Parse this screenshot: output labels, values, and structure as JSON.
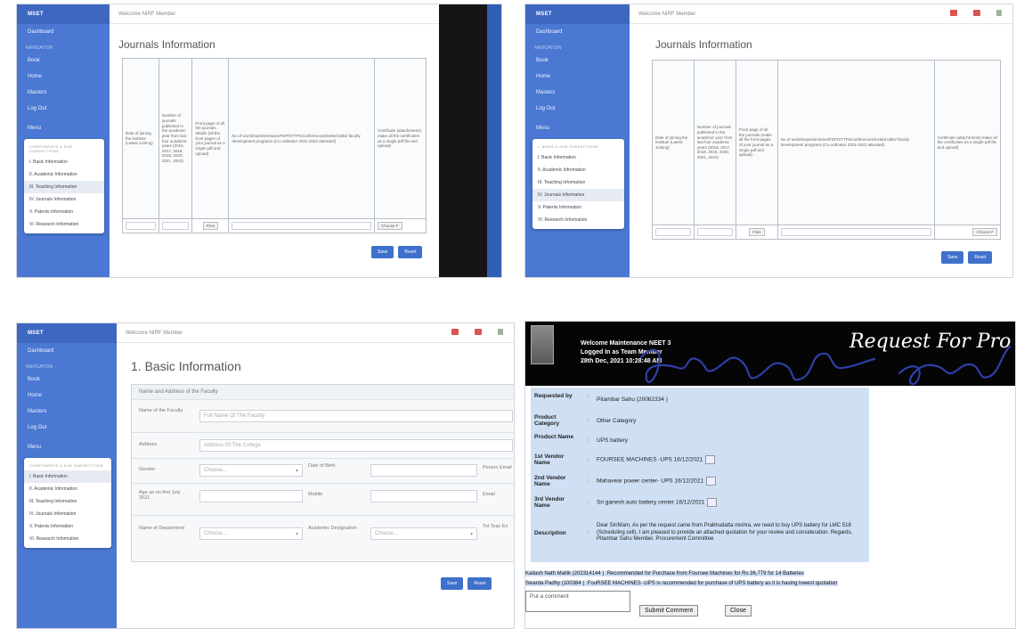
{
  "q1": {
    "brand": "MSET",
    "topbar_text": "Welcome NIRF Member",
    "page_title": "Journals Information",
    "nav": [
      "Dashboard",
      "Book",
      "Home",
      "Masters",
      "Log Out"
    ],
    "nav_section": "NAVIGATION",
    "menu_label": "Menu",
    "menu_header": "COMPONENTS & SUB SUBSECTIONS",
    "menu_items": [
      "I. Basic Information",
      "II. Academic Information",
      "III. Teaching Information",
      "IV. Journals Information",
      "V. Patents Information",
      "VI. Research Information"
    ],
    "table_headers": [
      "Date of joining the institute (Latest Joining)",
      "Number of journals published in the academic year from last four academic years (2016, 2017, 2018, 2019, 2020, 2021, 2022)",
      "Front page of all the journals details (all the front pages of your journal as a single pdf and upload)",
      "No of workshops/seminars/FDP/STTPs/conferences/invited talks/ faculty development programs (Co-ordinator 2021-2022 attended)",
      "Certificate (attachments) make all the certificates as a single pdf file and upload)"
    ],
    "file_button": "Files",
    "file_button2": "Choose F",
    "save": "Save",
    "reset": "Reset"
  },
  "q2": {
    "brand": "MSET",
    "topbar_text": "Welcome NIRF Member",
    "page_title": "Journals Information",
    "nav": [
      "Dashboard",
      "Book",
      "Home",
      "Masters",
      "Log Out"
    ],
    "nav_section": "NAVIGATION",
    "menu_label": "Menu",
    "menu_items": [
      "I. NEWS & SUB SUBSECTIONS",
      "I. Basic Information",
      "II. Academic Information",
      "III. Teaching Information",
      "IV. Journals Information",
      "V. Patents Information",
      "VI. Research Information"
    ],
    "table_headers": [
      "Date of joining the institute (Latest Joining)",
      "Number of journals published in the academic year from last four academic years (2016, 2017, 2018, 2019, 2020, 2021, 2022)",
      "Front page of all the journals (make all the front pages of your journal as a single pdf and upload)",
      "No of workshops/seminars/FDP/STTPs/conferences/invited talks/ faculty development programs (Co-ordinator 2021-2022 attended)",
      "Certificate (attachments) make all the certificates as a single pdf file and upload)"
    ],
    "file_button": "Files",
    "file_button2": "Choose F",
    "save": "Save",
    "reset": "Reset"
  },
  "q3": {
    "brand": "MSET",
    "topbar_text": "Welcome NIRF Member",
    "page_title": "1. Basic Information",
    "nav": [
      "Dashboard",
      "Book",
      "Home",
      "Masters",
      "Log Out"
    ],
    "nav_section": "NAVIGATION",
    "menu_label": "Menu",
    "menu_header": "COMPONENTS & SUB SUBSECTIONS",
    "menu_items": [
      "I. Basic Information",
      "II. Academic Information",
      "III. Teaching Information",
      "IV. Journals Information",
      "V. Patents Information",
      "VI. Research Information"
    ],
    "form_header": "Name and Address of the Faculty",
    "name_label": "Name of the Faculty",
    "name_placeholder": "Full Name Of The Faculty",
    "address_label": "Address",
    "address_placeholder": "Address Of The College",
    "gender_label": "Gender",
    "choose": "Choose...",
    "dob_label": "Date of Birth",
    "email_label": "Person Email",
    "age_label": "Age as on first July 2021",
    "mobile_label": "Mobile",
    "email2_label": "Email",
    "dept_label": "Name of Department",
    "desig_label": "Academic Designation",
    "total_label": "Tot Teac Ex",
    "save": "Save",
    "reset": "Reset"
  },
  "q4": {
    "welcome_line1": "Welcome Maintenance NEET 3",
    "welcome_line2": "Logged In as Team Member",
    "welcome_line3": "28th Dec, 2021 10:28:48 AM",
    "title": "Request For Pro",
    "fields": [
      {
        "key": "Requested by",
        "value": "Pitambar Sahu (20062334 )"
      },
      {
        "key": "Product Category",
        "value": "Other Category"
      },
      {
        "key": "Product Name",
        "value": "UPS battery"
      },
      {
        "key": "1st Vendor Name",
        "value": "FOURSEE MACHINES -UPS 16/12/2021"
      },
      {
        "key": "2nd Vendor Name",
        "value": "Mahavear power center- UPS 16/12/2021"
      },
      {
        "key": "3rd Vendor Name",
        "value": "Sri ganesh auto battery center 16/12/2021"
      }
    ],
    "description_key": "Description",
    "description": "Dear Sir/Mam, As per the request came from Prabhudatta mishra, we need to buy UPS battery for LMC 518 (Scheduling cell). I am pleased to provide an attached quotation for your review and consideration. Regards, Pitambar Sahu Member, Procurement Committee",
    "comment1": "Kailash Nath Mallik (202314144 ) :Recommended for Purchase from Foursee Machines for Rs 36,779 for 14 Batteries",
    "comment2": "Swarda Padhy (100384 ) :FouRSEE MACHINES -UPS is recommended for purchase of UPS battery as it is having lowest quotation",
    "comment_placeholder": "Put a comment",
    "submit_comment": "Submit Comment",
    "close": "Close"
  }
}
